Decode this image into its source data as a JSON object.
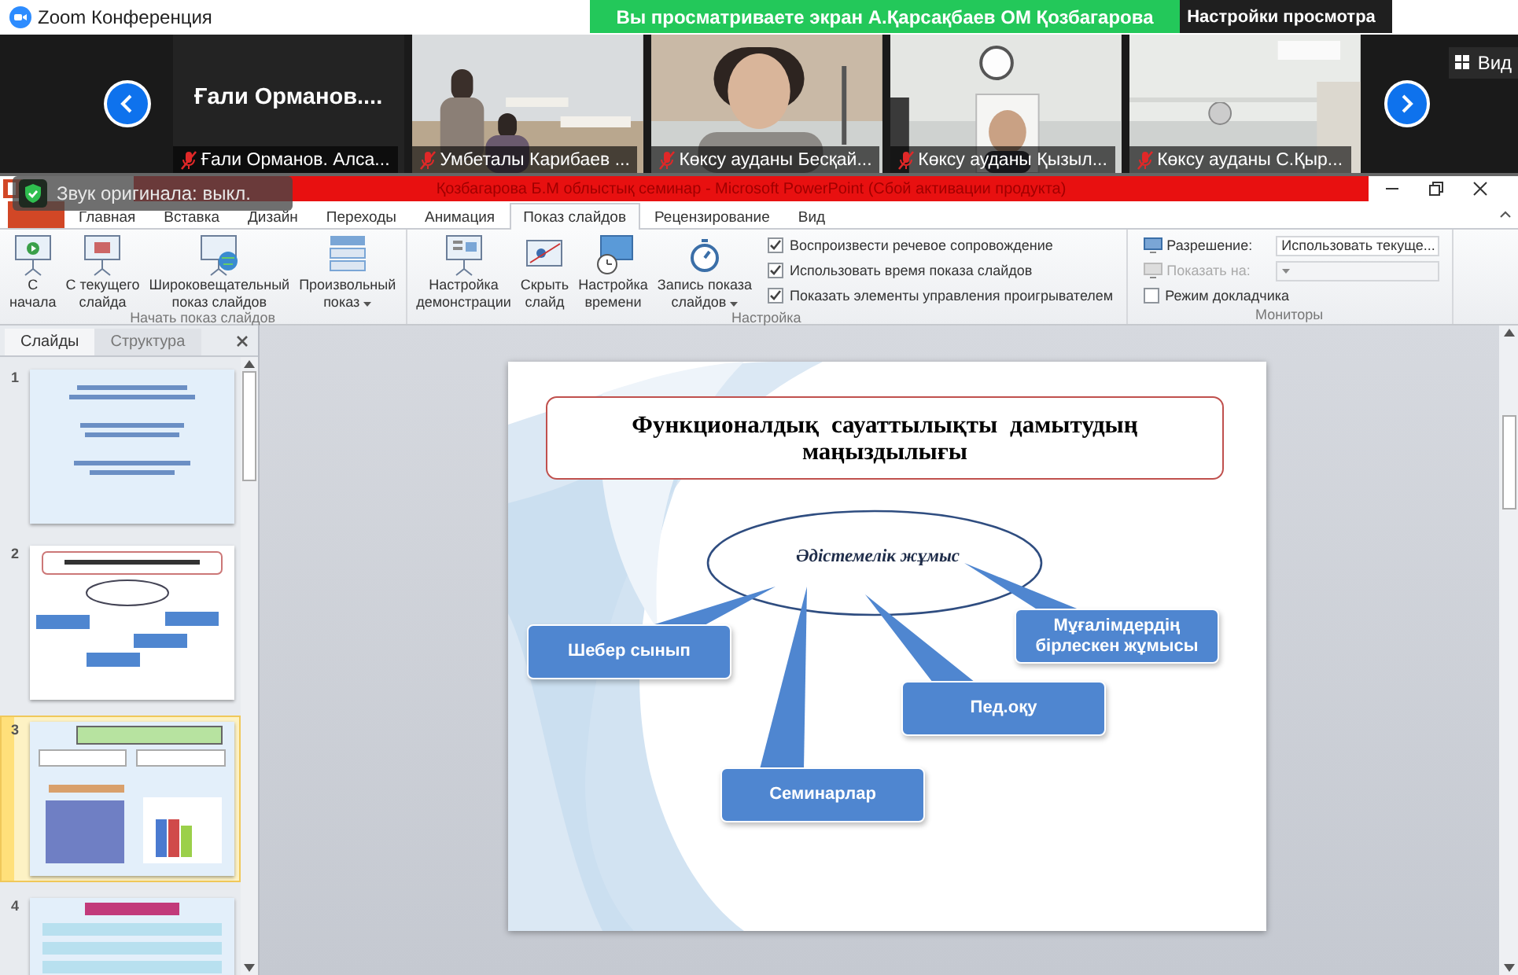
{
  "zoom_window": {
    "title": "Zoom Конференция"
  },
  "share_banner": {
    "text": "Вы просматриваете экран А.Қарсақбаев ОМ Қозбагарова",
    "view_options": "Настройки просмотра"
  },
  "gallery": {
    "tiles": [
      {
        "kind": "name",
        "name": "Ғали Орманов....",
        "label": "Ғали Орманов. Алса...",
        "muted": true
      },
      {
        "kind": "video",
        "label": "Умбеталы Карибаев ...",
        "muted": true
      },
      {
        "kind": "video",
        "label": "Көксу ауданы Бесқай...",
        "muted": true
      },
      {
        "kind": "video",
        "label": "Көксу ауданы Қызыл...",
        "muted": true
      },
      {
        "kind": "video",
        "label": "Көксу ауданы С.Қыр...",
        "muted": true
      }
    ],
    "view_button": "Вид"
  },
  "audio_notice": {
    "text": "Звук оригинала: выкл."
  },
  "powerpoint": {
    "title": "Қозбагарова Б.М облыстық семинар - Microsoft PowerPoint (Сбой активации продукта)",
    "tabs": [
      {
        "label": "Главная",
        "selected": false
      },
      {
        "label": "Вставка",
        "selected": false
      },
      {
        "label": "Дизайн",
        "selected": false
      },
      {
        "label": "Переходы",
        "selected": false
      },
      {
        "label": "Анимация",
        "selected": false
      },
      {
        "label": "Показ слайдов",
        "selected": true
      },
      {
        "label": "Рецензирование",
        "selected": false
      },
      {
        "label": "Вид",
        "selected": false
      }
    ],
    "ribbon": [
      {
        "label": "Начать показ слайдов",
        "items": [
          {
            "kind": "button",
            "label": "С\nначала",
            "dropdown": false
          },
          {
            "kind": "button",
            "label": "С текущего\nслайда",
            "dropdown": false
          },
          {
            "kind": "button",
            "label": "Широковещательный\nпоказ слайдов",
            "dropdown": false
          },
          {
            "kind": "button",
            "label": "Произвольный\nпоказ",
            "dropdown": true
          }
        ]
      },
      {
        "label": "Настройка",
        "items": [
          {
            "kind": "button",
            "label": "Настройка\nдемонстрации",
            "dropdown": false
          },
          {
            "kind": "button",
            "label": "Скрыть\nслайд",
            "dropdown": false
          },
          {
            "kind": "button",
            "label": "Настройка\nвремени",
            "dropdown": false
          },
          {
            "kind": "button",
            "label": "Запись показа\nслайдов",
            "dropdown": true
          },
          {
            "kind": "checkbox",
            "label": "Воспроизвести речевое сопровождение",
            "checked": true
          },
          {
            "kind": "checkbox",
            "label": "Использовать время показа слайдов",
            "checked": true
          },
          {
            "kind": "checkbox",
            "label": "Показать элементы управления проигрывателем",
            "checked": true
          }
        ]
      },
      {
        "label": "Мониторы",
        "items": [
          {
            "kind": "select",
            "label": "Разрешение:",
            "value": "Использовать текуще...",
            "disabled": false
          },
          {
            "kind": "select",
            "label": "Показать на:",
            "disabled": true
          },
          {
            "kind": "checkbox",
            "label": "Режим докладчика",
            "checked": false
          }
        ]
      }
    ],
    "slides_panel": {
      "tabs": [
        {
          "label": "Слайды",
          "selected": true
        },
        {
          "label": "Структура",
          "selected": false
        }
      ],
      "thumbnails": [
        {
          "number": "1",
          "selected": false
        },
        {
          "number": "2",
          "selected": false
        },
        {
          "number": "3",
          "selected": true
        },
        {
          "number": "4",
          "selected": false
        }
      ]
    },
    "slide": {
      "title": "Функционалдық  сауаттылықты дамытудың маңыздылығы",
      "center": "Әдістемелік жұмыс",
      "callouts": [
        {
          "text": "Шебер сынып"
        },
        {
          "text": "Семинарлар"
        },
        {
          "text": "Пед.оқу"
        },
        {
          "text": "Мұғалімдердің бірлескен жұмысы"
        }
      ]
    }
  }
}
